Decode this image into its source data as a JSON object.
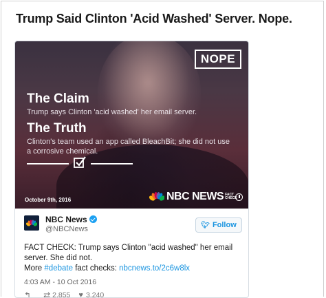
{
  "headline": "Trump Said Clinton 'Acid Washed' Server. Nope.",
  "media": {
    "badge": "NOPE",
    "claim_title": "The Claim",
    "claim_text": "Trump says Clinton 'acid washed' her email server.",
    "truth_title": "The Truth",
    "truth_text": "Clinton's team used an app called BleachBit; she did not use a corrosive chemical.",
    "date": "October 9th, 2016",
    "brand": "NBC NEWS",
    "brand_sub": "FACT CHECK"
  },
  "tweet": {
    "name": "NBC News",
    "handle": "@NBCNews",
    "follow_label": "Follow",
    "text_part1": "FACT CHECK: Trump says Clinton \"acid washed\" her email server. She did not.",
    "text_more": "More",
    "hashtag": "#debate",
    "text_fact": "fact checks:",
    "link": "nbcnews.to/2c6w8lx",
    "timestamp": "4:03 AM - 10 Oct 2016",
    "retweets": "2,855",
    "likes": "3,240"
  },
  "colors": {
    "accent": "#1b95e0",
    "verified": "#1da1f2",
    "nbc_peacock": [
      "#fcb711",
      "#f37021",
      "#cc004c",
      "#6460aa",
      "#0089d0",
      "#0db14b"
    ]
  }
}
